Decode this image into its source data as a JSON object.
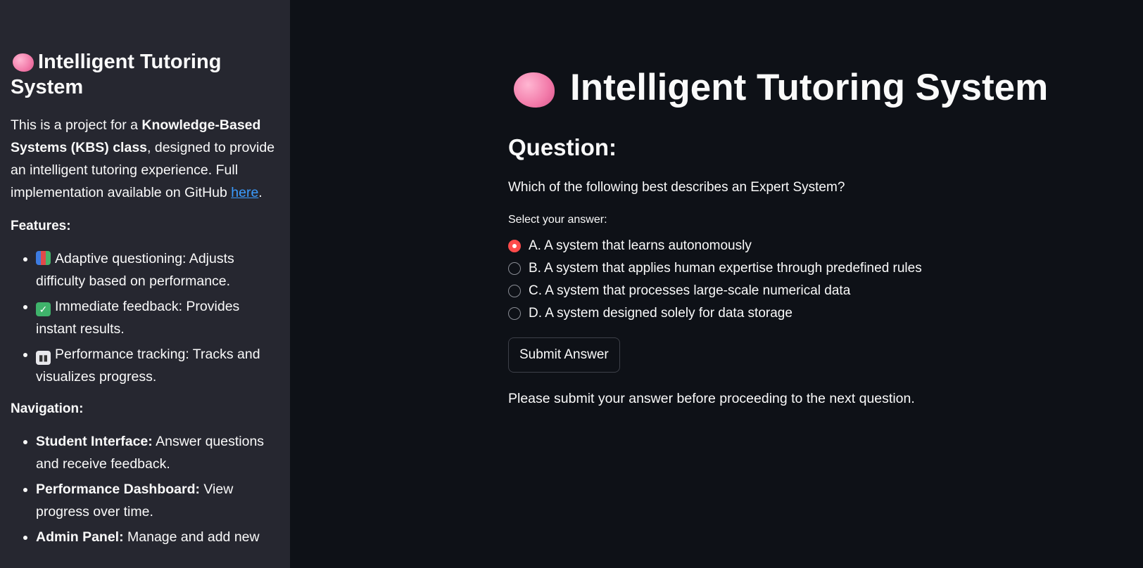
{
  "colors": {
    "sidebar_bg": "#262730",
    "main_bg": "#0e1117",
    "accent_red": "#ff4b4b",
    "link_blue": "#3b9cff"
  },
  "sidebar": {
    "title": "Intelligent Tutoring System",
    "intro": {
      "before": "This is a project for a ",
      "bold": "Knowledge-Based Systems (KBS) class",
      "middle": ", designed to provide an intelligent tutoring experience. Full implementation available on GitHub ",
      "link": "here",
      "after": "."
    },
    "features_heading": "Features:",
    "features": [
      {
        "icon": "books-icon",
        "text": "Adaptive questioning: Adjusts difficulty based on performance."
      },
      {
        "icon": "check-mark-icon",
        "text": "Immediate feedback: Provides instant results."
      },
      {
        "icon": "bar-chart-icon",
        "text": "Performance tracking: Tracks and visualizes progress."
      }
    ],
    "navigation_heading": "Navigation:",
    "navigation": [
      {
        "bold": "Student Interface:",
        "text": " Answer questions and receive feedback."
      },
      {
        "bold": "Performance Dashboard:",
        "text": " View progress over time."
      },
      {
        "bold": "Admin Panel:",
        "text": " Manage and add new"
      }
    ]
  },
  "main": {
    "title": "Intelligent Tutoring System",
    "question_heading": "Question:",
    "question": "Which of the following best describes an Expert System?",
    "select_label": "Select your answer:",
    "options": [
      "A. A system that learns autonomously",
      "B. A system that applies human expertise through predefined rules",
      "C. A system that processes large-scale numerical data",
      "D. A system designed solely for data storage"
    ],
    "selected_option": "A. A system that learns autonomously",
    "submit_label": "Submit Answer",
    "note": "Please submit your answer before proceeding to the next question."
  }
}
